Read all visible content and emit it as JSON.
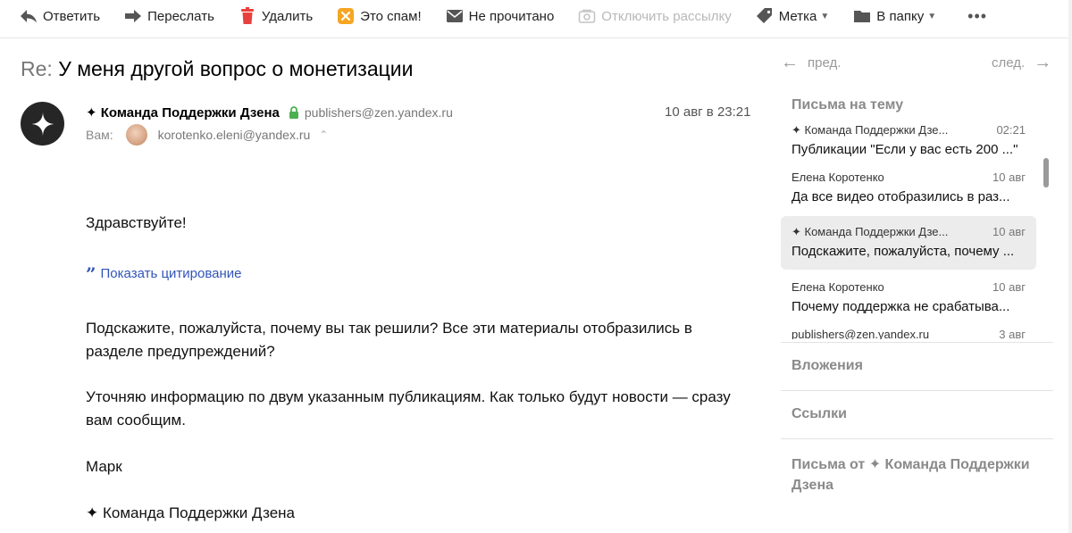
{
  "toolbar": {
    "reply": "Ответить",
    "forward": "Переслать",
    "delete": "Удалить",
    "spam": "Это спам!",
    "unread": "Не прочитано",
    "unsubscribe": "Отключить рассылку",
    "label": "Метка",
    "folder": "В папку",
    "more": "•••"
  },
  "message": {
    "subject_prefix": "Re:",
    "subject": "У меня другой вопрос о монетизации",
    "sender_name": "✦ Команда Поддержки Дзена",
    "sender_email": "publishers@zen.yandex.ru",
    "date": "10 авг в 23:21",
    "to_label": "Вам:",
    "to_email": "korotenko.eleni@yandex.ru",
    "to_caret": "⌃",
    "greeting": "Здравствуйте!",
    "quote_link": "Показать цитирование",
    "quote_mark": "”",
    "paragraph1": "Подскажите, пожалуйста, почему вы так решили? Все эти материалы отобразились в разделе предупреждений?",
    "paragraph2": "Уточняю информацию по двум указанным публикациям. Как только будут новости — сразу вам сообщим.",
    "signature_name": "Марк",
    "signature_team": "✦ Команда Поддержки Дзена"
  },
  "nav": {
    "prev": "пред.",
    "next": "след.",
    "prev_arrow": "←",
    "next_arrow": "→"
  },
  "sidebar": {
    "thread_title": "Письма на тему",
    "threads": [
      {
        "from": "✦ Команда Поддержки Дзе...",
        "date": "02:21",
        "snippet": "Публикации \"Если у вас есть 200 ...\""
      },
      {
        "from": "Елена Коротенко",
        "date": "10 авг",
        "snippet": "Да все видео отобразились в раз..."
      },
      {
        "from": "✦ Команда Поддержки Дзе...",
        "date": "10 авг",
        "snippet": "Подскажите, пожалуйста, почему ..."
      },
      {
        "from": "Елена Коротенко",
        "date": "10 авг",
        "snippet": "Почему поддержка не срабатыва..."
      },
      {
        "from": "publishers@zen.yandex.ru",
        "date": "3 авг",
        "snippet": ""
      }
    ],
    "attachments": "Вложения",
    "links": "Ссылки",
    "from_sender_line1": "Письма от ✦ Команда Поддержки",
    "from_sender_line2": "Дзена"
  },
  "colors": {
    "link": "#3254b8",
    "delete_icon": "#e8413d",
    "spam_icon": "#f5a623",
    "lock_icon": "#4caf50",
    "selected_bg": "#ececec"
  }
}
